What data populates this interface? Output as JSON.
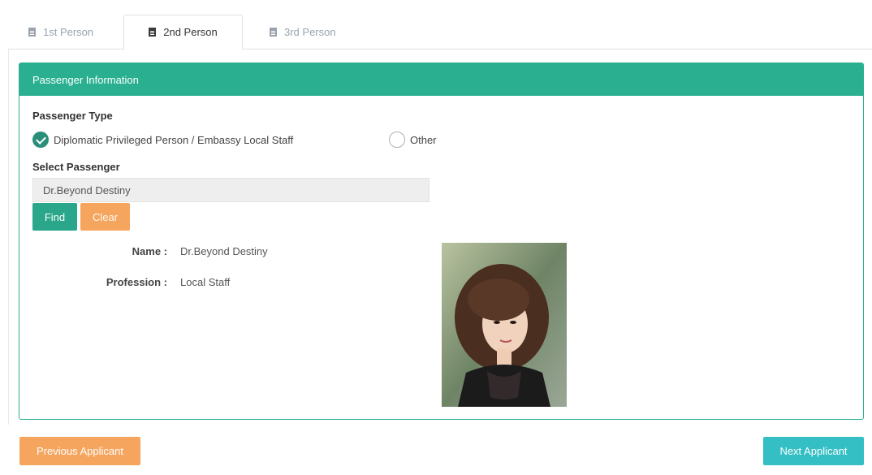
{
  "tabs": [
    {
      "label": "1st Person",
      "icon": "document-icon",
      "active": false
    },
    {
      "label": "2nd Person",
      "icon": "document-icon",
      "active": true
    },
    {
      "label": "3rd Person",
      "icon": "document-icon",
      "active": false
    }
  ],
  "panel": {
    "title": "Passenger Information",
    "passenger_type_label": "Passenger Type",
    "options": [
      {
        "label": "Diplomatic Privileged Person / Embassy Local Staff",
        "checked": true
      },
      {
        "label": "Other",
        "checked": false
      }
    ],
    "select_label": "Select Passenger",
    "select_value": "Dr.Beyond Destiny",
    "find_label": "Find",
    "clear_label": "Clear",
    "details": {
      "name_key": "Name :",
      "name_value": "Dr.Beyond Destiny",
      "profession_key": "Profession :",
      "profession_value": "Local Staff"
    }
  },
  "footer": {
    "prev_label": "Previous Applicant",
    "next_label": "Next Applicant"
  },
  "colors": {
    "header_green": "#2ab090",
    "find_green": "#2aa68a",
    "clear_orange": "#f5a55e",
    "next_teal": "#34bfc4"
  }
}
